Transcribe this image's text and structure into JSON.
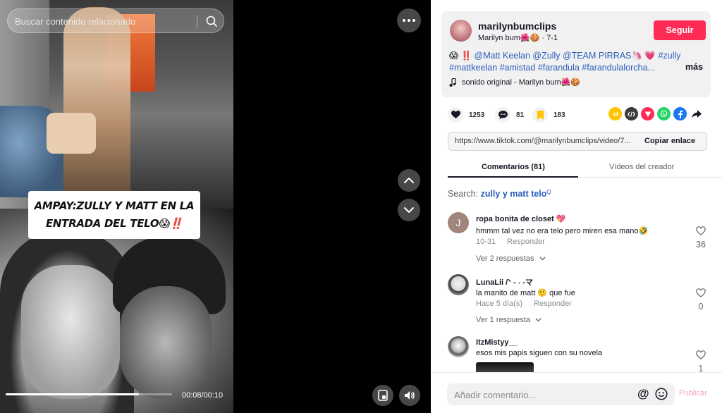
{
  "video": {
    "caption": "AMPAY:ZULLY Y MATT EN LA ENTRADA DEL TELO😱‼️",
    "current_time": "00:08/00:10",
    "progress": 0.8
  },
  "search": {
    "placeholder": "Buscar contenido relacionado"
  },
  "author": {
    "username": "marilynbumclips",
    "nickname": "Marilyn bum🌺🍪",
    "date": "7-1",
    "follow_label": "Seguir"
  },
  "description": {
    "lead": "😱 ‼️ ",
    "text": "@Matt Keelan @Zully @TEAM PIRRAS🦄 💗 #zully #mattkeelan #amistad #farandula #farandulalorcha...",
    "more_label": "más"
  },
  "music": {
    "label": "sonido original - Marilyn bum🌺🍪"
  },
  "stats": {
    "likes": "1253",
    "comments": "81",
    "saves": "183"
  },
  "share_icons": [
    "repost-icon",
    "embed-icon",
    "send-icon",
    "whatsapp-icon",
    "facebook-icon",
    "share-arrow-icon"
  ],
  "colors": {
    "accent": "#fe2c55",
    "link": "#2b5db9",
    "repost": "#ffc300",
    "embed": "#3b3b3b",
    "send": "#fe2c55",
    "whatsapp": "#25d366",
    "facebook": "#1877f2"
  },
  "link": {
    "url": "https://www.tiktok.com/@marilynbumclips/video/7...",
    "copy_label": "Copiar enlace"
  },
  "tabs": {
    "comments": "Comentarios (81)",
    "creator": "Vídeos del creador"
  },
  "related_search": {
    "prefix": "Search: ",
    "term": "zully y matt telo"
  },
  "comments": [
    {
      "user": "ropa bonita de closet 💖",
      "text": "hmmm tal vez no era telo pero miren esa mano🤣",
      "date": "10-31",
      "reply_label": "Responder",
      "likes": "36",
      "replies_label": "Ver 2 respuestas",
      "avatar_letter": "J"
    },
    {
      "user": "LunaLii /ᐠ - ˕ -マ",
      "text": "la manito de matt 🤨 que fue",
      "date": "Hace 5 día(s)",
      "reply_label": "Responder",
      "likes": "0",
      "replies_label": "Ver 1 respuesta"
    },
    {
      "user": "ItzMistyy__",
      "text": "esos mis papis siguen con su novela",
      "likes": "1"
    }
  ],
  "composer": {
    "placeholder": "Añadir comentario...",
    "at_symbol": "@",
    "publish_label": "Publicar"
  }
}
